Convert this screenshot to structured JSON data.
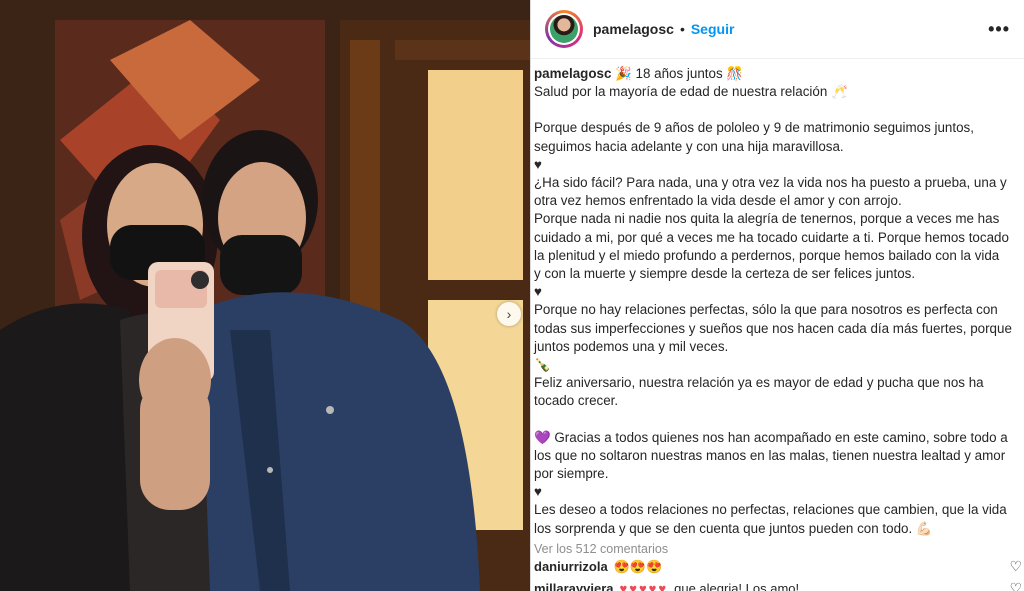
{
  "header": {
    "username": "pamelagosc",
    "separator": "•",
    "follow_label": "Seguir",
    "more_label": "•••"
  },
  "caption": {
    "username": "pamelagosc",
    "line1": "🎉 18 años juntos 🎊",
    "line2": "Salud por la mayoría de edad de nuestra relación 🥂",
    "para1": "Porque después de 9 años de pololeo y 9 de matrimonio seguimos juntos,\nseguimos hacia adelante y con una hija maravillosa.",
    "sep1": "♥",
    "para2": "¿Ha sido fácil? Para nada, una y otra vez la vida nos ha puesto a prueba, una y\notra vez hemos enfrentado la vida desde el amor y con arrojo.\nPorque nada ni nadie nos quita la alegría de tenernos, porque a veces me has\ncuidado a mi, por qué a veces me ha tocado cuidarte a ti. Porque hemos tocado\nla plenitud y el miedo profundo a perdernos, porque hemos bailado con la vida\ny con la muerte y siempre desde la certeza de ser felices juntos.",
    "sep2": "♥",
    "para3": "Porque no hay relaciones perfectas, sólo la que para nosotros es perfecta con\ntodas sus imperfecciones y sueños que nos hacen cada día más fuertes, porque\njuntos podemos una y mil veces.",
    "sep3": "🍾",
    "para4": "Feliz aniversario, nuestra relación ya es mayor de edad y pucha que nos ha\ntocado crecer.",
    "para5": "💜 Gracias a todos quienes nos han acompañado en este camino, sobre todo a\nlos que no soltaron nuestras manos en las malas, tienen nuestra lealtad y amor\npor siempre.",
    "sep4": "♥",
    "para6": "Les deseo a todos relaciones no perfectas, relaciones que cambien, que la vida\nlos sorprenda y que se den cuenta que juntos pueden con todo. 💪🏻"
  },
  "view_comments": "Ver los 512 comentarios",
  "comments": [
    {
      "user": "daniurrizola",
      "text": "😍😍😍"
    },
    {
      "user": "millarayviera",
      "hearts": "♥♥♥♥♥",
      "text": "que alegria! Los amo!"
    }
  ],
  "icons": {
    "like": "heart-outline-icon",
    "next": "chevron-right-icon"
  },
  "colors": {
    "follow": "#0095f6",
    "muted": "#8e8e8e",
    "heart_red": "#ed4956"
  }
}
